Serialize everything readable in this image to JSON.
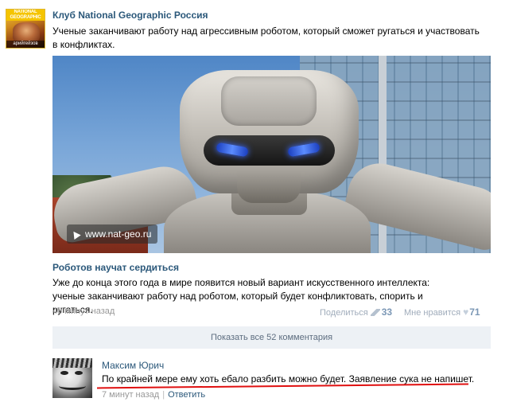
{
  "post": {
    "author": "Клуб National Geographic Россия",
    "text": "Ученые заканчивают работу над агрессивным роботом, который сможет ругаться и участвовать в конфликтах.",
    "avatar": {
      "top_text": "NATIONAL GEOGRAPHIC",
      "bottom_text": "арийгейзов"
    },
    "media": {
      "watermark": "www.nat-geo.ru"
    },
    "link": {
      "title": "Роботов научат сердиться",
      "description": "Уже до конца этого года в мире появится новый вариант искусственного интеллекта: ученые заканчивают работу над роботом, который будет конфликтовать, спорить и ругаться."
    },
    "footer": {
      "time": "48 минут назад",
      "share_label": "Поделиться",
      "share_count": "33",
      "like_label": "Мне нравится",
      "like_count": "71"
    },
    "show_comments_label": "Показать все 52 комментария"
  },
  "comment": {
    "author": "Максим Юрич",
    "text": "По крайней мере ему хоть ебало разбить можно будет. Заявление сука не напишет.",
    "time": "7 минут назад",
    "separator": "|",
    "reply_label": "Ответить",
    "underline_color": "#e01010"
  },
  "colors": {
    "link": "#2b587a",
    "meta": "#999999",
    "counter": "#7b97b5",
    "comments_bar": "#edf1f5"
  },
  "icons": [
    "share-megaphone-icon",
    "heart-icon",
    "external-link-arrow-icon"
  ]
}
